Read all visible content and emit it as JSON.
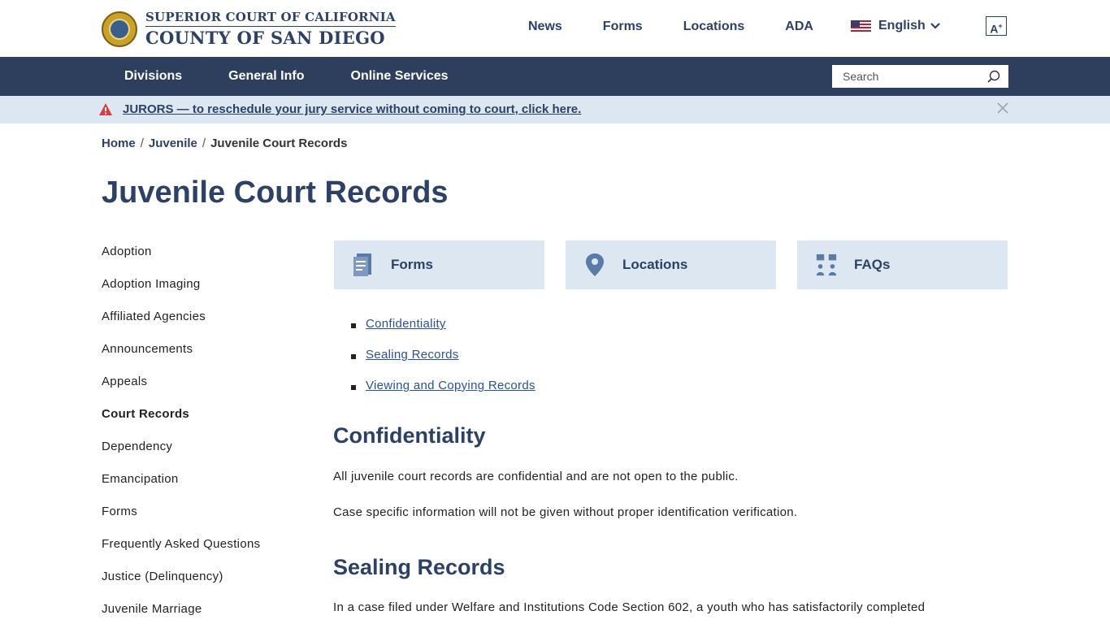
{
  "header": {
    "logo_line1": "SUPERIOR COURT OF CALIFORNIA",
    "logo_line2": "COUNTY OF SAN DIEGO",
    "top_links": [
      "News",
      "Forms",
      "Locations",
      "ADA"
    ],
    "language": "English",
    "font_size_label": "A"
  },
  "nav": {
    "items": [
      "Divisions",
      "General Info",
      "Online Services"
    ],
    "search_placeholder": "Search"
  },
  "alert": {
    "text": "JURORS — to reschedule your jury service without coming to court, click here."
  },
  "breadcrumb": [
    "Home",
    "Juvenile",
    "Juvenile Court Records"
  ],
  "page_title": "Juvenile Court Records",
  "sidebar": {
    "items": [
      "Adoption",
      "Adoption Imaging",
      "Affiliated Agencies",
      "Announcements",
      "Appeals",
      "Court Records",
      "Dependency",
      "Emancipation",
      "Forms",
      "Frequently Asked Questions",
      "Justice (Delinquency)",
      "Juvenile Marriage"
    ],
    "active": "Court Records"
  },
  "cards": [
    {
      "label": "Forms",
      "icon": "document-icon"
    },
    {
      "label": "Locations",
      "icon": "map-pin-icon"
    },
    {
      "label": "FAQs",
      "icon": "people-question-icon"
    }
  ],
  "toc": [
    "Confidentiality",
    "Sealing Records",
    "Viewing and Copying Records"
  ],
  "sections": {
    "confidentiality": {
      "heading": "Confidentiality",
      "p1": "All juvenile court records are confidential and are not open to the public.",
      "p2": "Case specific information will not be given without proper identification verification."
    },
    "sealing": {
      "heading": "Sealing Records",
      "p1": "In a case filed under Welfare and Institutions Code Section 602, a youth who has satisfactorily completed"
    }
  },
  "colors": {
    "brand_navy": "#2e3f5e",
    "accent_light": "#dde7f1",
    "link": "#2a5298",
    "alert_icon": "#e0393e"
  }
}
